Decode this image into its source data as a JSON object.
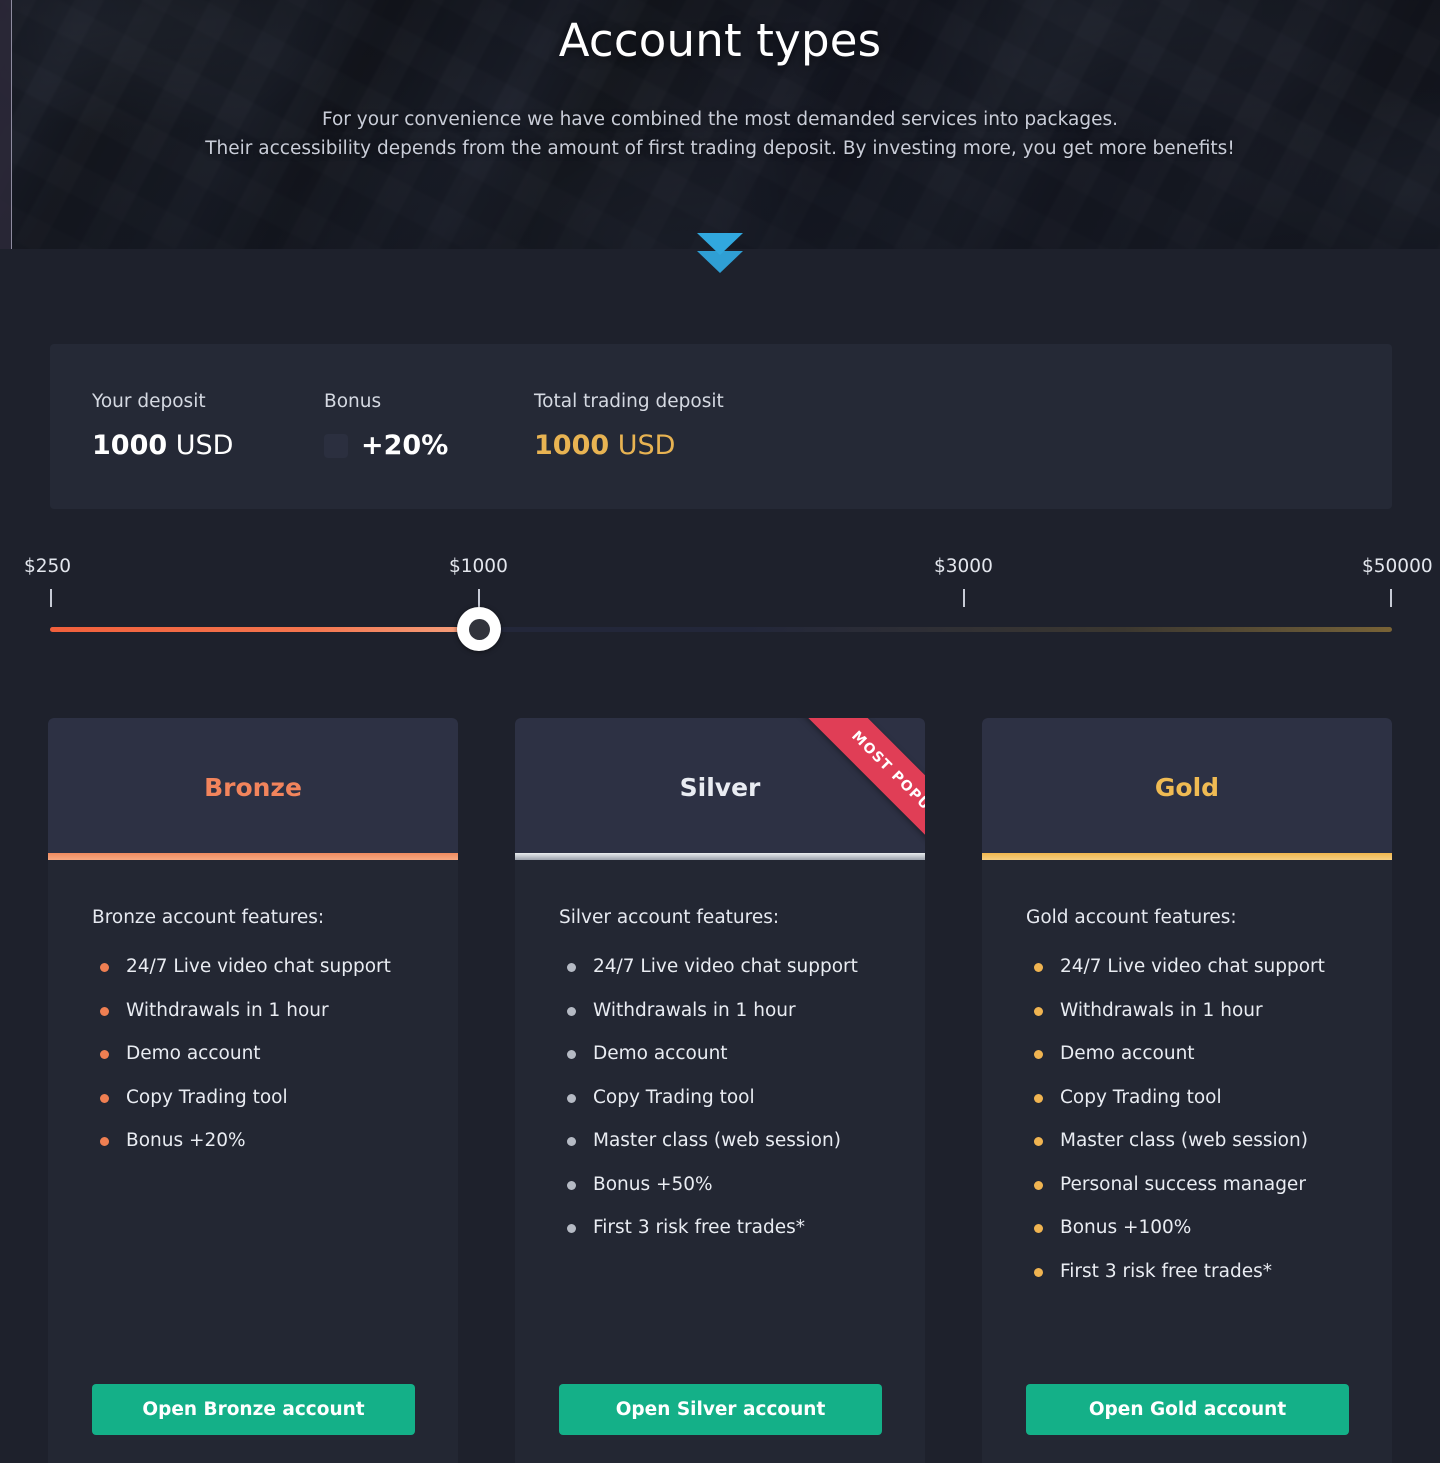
{
  "hero": {
    "title": "Account types",
    "subtitle_line1": "For your convenience we have combined the most demanded services into packages.",
    "subtitle_line2": "Their accessibility depends from the amount of first trading deposit. By investing more, you get more benefits!",
    "scroll_cue_icon": "double-chevron-down-icon"
  },
  "deposit": {
    "your_deposit_label": "Your deposit",
    "your_deposit_amount": "1000",
    "your_deposit_currency": "USD",
    "bonus_label": "Bonus",
    "bonus_value": "+20%",
    "total_label": "Total trading deposit",
    "total_amount": "1000",
    "total_currency": "USD",
    "total_color": "#e8b352"
  },
  "slider": {
    "ticks": [
      "$250",
      "$1000",
      "$3000",
      "$50000"
    ],
    "current_value": "$1000",
    "fill_color": "#f1603c",
    "handle_color": "#ffffff"
  },
  "cards": [
    {
      "name": "Bronze",
      "accent": "#f2845c",
      "features_title": "Bronze account features:",
      "features": [
        "24/7 Live video chat support",
        "Withdrawals in 1 hour",
        "Demo account",
        "Copy Trading tool",
        "Bonus +20%"
      ],
      "cta": "Open Bronze account",
      "badge": ""
    },
    {
      "name": "Silver",
      "accent": "#e9ecf2",
      "features_title": "Silver account features:",
      "features": [
        "24/7 Live video chat support",
        "Withdrawals in 1 hour",
        "Demo account",
        "Copy Trading tool",
        "Master class (web session)",
        "Bonus +50%",
        "First 3 risk free trades*"
      ],
      "cta": "Open Silver account",
      "badge": "MOST POPULAR"
    },
    {
      "name": "Gold",
      "accent": "#f0bb53",
      "features_title": "Gold account features:",
      "features": [
        "24/7 Live video chat support",
        "Withdrawals in 1 hour",
        "Demo account",
        "Copy Trading tool",
        "Master class (web session)",
        "Personal success manager",
        "Bonus +100%",
        "First 3 risk free trades*"
      ],
      "cta": "Open Gold account",
      "badge": ""
    }
  ]
}
